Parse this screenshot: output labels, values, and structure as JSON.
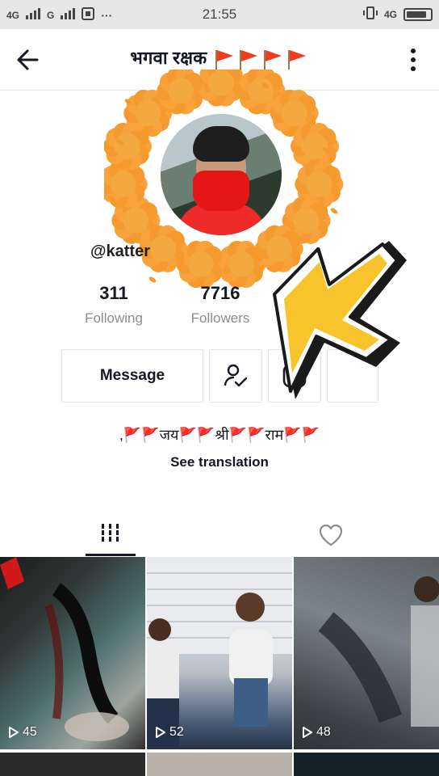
{
  "status_bar": {
    "network_1": "4G",
    "network_2": "G",
    "time": "21:55",
    "right_network": "4G",
    "battery_level": 0.85
  },
  "header": {
    "title": "भगवा रक्षक",
    "flag_count": 4
  },
  "profile": {
    "username": "@katter",
    "following_count": "311",
    "following_label": "Following",
    "followers_count": "7716",
    "followers_label": "Followers"
  },
  "actions": {
    "message_label": "Message"
  },
  "bio": {
    "text": ",🚩🚩जय🚩🚩श्री🚩🚩राम🚩🚩",
    "see_translation": "See translation"
  },
  "videos": [
    {
      "views": "45"
    },
    {
      "views": "52"
    },
    {
      "views": "48"
    }
  ],
  "colors": {
    "text_primary": "#161823",
    "text_secondary": "#8a8b91",
    "flag_red": "#f23b1a",
    "marigold": "#f7a23b",
    "arrow_yellow": "#f7c52b"
  }
}
